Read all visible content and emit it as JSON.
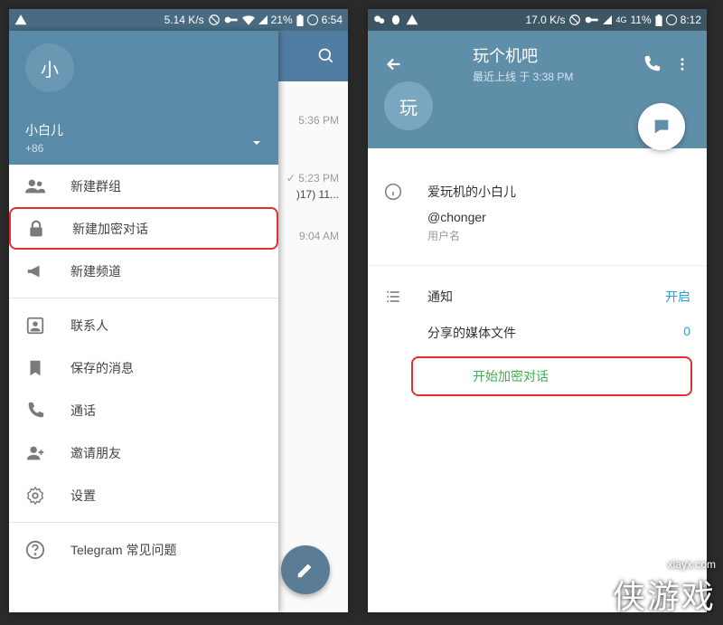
{
  "left": {
    "status": {
      "net": "5.14 K/s",
      "battery": "21%",
      "time": "6:54"
    },
    "header": {
      "avatar_char": "小",
      "username": "小白儿",
      "phone": "+86"
    },
    "menu": {
      "new_group": "新建群组",
      "new_secret": "新建加密对话",
      "new_channel": "新建频道",
      "contacts": "联系人",
      "saved": "保存的消息",
      "calls": "通话",
      "invite": "邀请朋友",
      "settings": "设置",
      "faq": "Telegram 常见问题"
    },
    "chat_preview": {
      "t1": "5:36 PM",
      "t2": "5:23 PM",
      "t2_text": ")17) 11...",
      "t3": "9:04 AM"
    }
  },
  "right": {
    "status": {
      "net": "17.0 K/s",
      "sig": "4G",
      "battery": "11%",
      "time": "8:12"
    },
    "header": {
      "avatar_char": "玩",
      "title": "玩个机吧",
      "subtitle": "最近上线 于 3:38 PM"
    },
    "info": {
      "name": "爱玩机的小白儿",
      "username": "@chonger",
      "username_label": "用户名",
      "notif_label": "通知",
      "notif_value": "开启",
      "media_label": "分享的媒体文件",
      "media_value": "0",
      "secret_chat": "开始加密对话"
    }
  },
  "watermark": {
    "site": "xiayx.com",
    "text": "侠游戏"
  }
}
